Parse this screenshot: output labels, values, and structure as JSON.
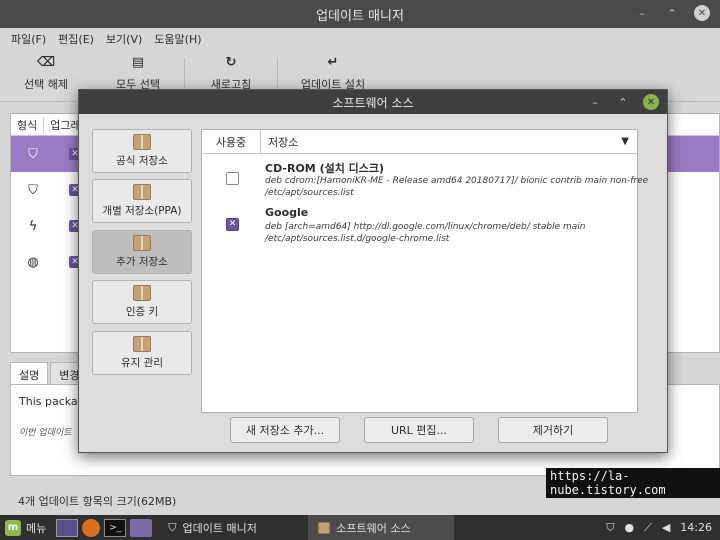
{
  "main_window": {
    "title": "업데이트 매니저",
    "menu": [
      "파일(F)",
      "편집(E)",
      "보기(V)",
      "도움말(H)"
    ],
    "toolbar": [
      {
        "icon": "backspace-icon",
        "label": "선택 해제"
      },
      {
        "icon": "document-icon",
        "label": "모두 선택"
      },
      {
        "icon": "refresh-icon",
        "label": "새로고침"
      },
      {
        "icon": "return-arrow-icon",
        "label": "업데이트 설치"
      }
    ],
    "table_headers": [
      "형식",
      "업그레이드"
    ],
    "rows": [
      {
        "icon": "shield-icon",
        "selected": true
      },
      {
        "icon": "shield-icon",
        "selected": false
      },
      {
        "icon": "bolt-icon",
        "selected": false
      },
      {
        "icon": "globe-icon",
        "selected": false
      }
    ],
    "tabs": [
      "설명",
      "변경"
    ],
    "description": "This package",
    "description_note": "이번 업데이트",
    "status": "4개 업데이트 항목의 크기(62MB)"
  },
  "dialog": {
    "title": "소프트웨어 소스",
    "sidebar": [
      {
        "label": "공식 저장소",
        "active": false
      },
      {
        "label": "개별 저장소(PPA)",
        "active": false
      },
      {
        "label": "추가 저장소",
        "active": true
      },
      {
        "label": "인증 키",
        "active": false
      },
      {
        "label": "유지 관리",
        "active": false
      }
    ],
    "columns": {
      "enabled": "사용중",
      "repository": "저장소"
    },
    "repos": [
      {
        "name": "CD-ROM (설치 디스크)",
        "line1": "deb cdrom:[HamoniKR-ME - Release amd64 20180717]/ bionic contrib main non-free",
        "line2": "/etc/apt/sources.list",
        "enabled": false
      },
      {
        "name": "Google",
        "line1": "deb [arch=amd64] http://dl.google.com/linux/chrome/deb/ stable main",
        "line2": "/etc/apt/sources.list.d/google-chrome.list",
        "enabled": true
      }
    ],
    "buttons": {
      "add": "새 저장소 추가...",
      "edit": "URL 편집...",
      "remove": "제거하기"
    }
  },
  "watermark": "https://la-nube.tistory.com",
  "taskbar": {
    "menu_label": "메뉴",
    "tasks": [
      {
        "icon": "shield-icon",
        "label": "업데이트 매니저",
        "active": false
      },
      {
        "icon": "package-icon",
        "label": "소프트웨어 소스",
        "active": true
      }
    ],
    "clock": "14:26"
  },
  "colors": {
    "accent": "#6f55a1",
    "selection": "#9a7ac4",
    "close_button": "#8ab34f"
  }
}
